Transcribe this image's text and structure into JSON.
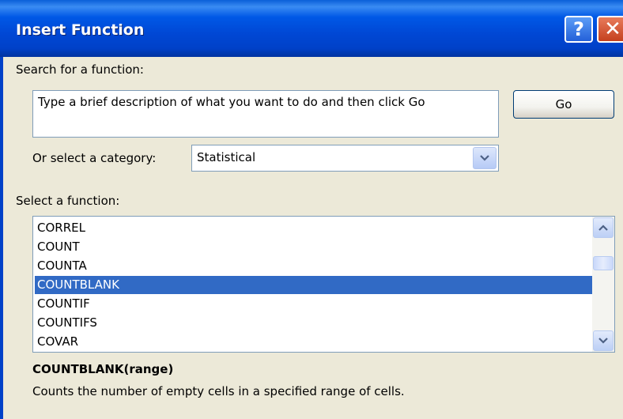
{
  "window": {
    "title": "Insert Function",
    "help_glyph": "?",
    "close_glyph": "✕"
  },
  "search": {
    "label": "Search for a function:",
    "value": "Type a brief description of what you want to do and then click Go",
    "go_label": "Go"
  },
  "category": {
    "label": "Or select a category:",
    "selected": "Statistical"
  },
  "functions": {
    "label": "Select a function:",
    "items": [
      "CORREL",
      "COUNT",
      "COUNTA",
      "COUNTBLANK",
      "COUNTIF",
      "COUNTIFS",
      "COVAR"
    ],
    "selected_index": 3
  },
  "details": {
    "syntax": "COUNTBLANK(range)",
    "description": "Counts the number of empty cells in a specified range of cells."
  },
  "icons": {
    "scroll_up": "chevron-up-icon",
    "scroll_down": "chevron-down-icon",
    "dropdown": "chevron-down-icon"
  },
  "colors": {
    "titlebar": "#0047d4",
    "selection": "#316ac5",
    "dialog_bg": "#ece9d8"
  }
}
